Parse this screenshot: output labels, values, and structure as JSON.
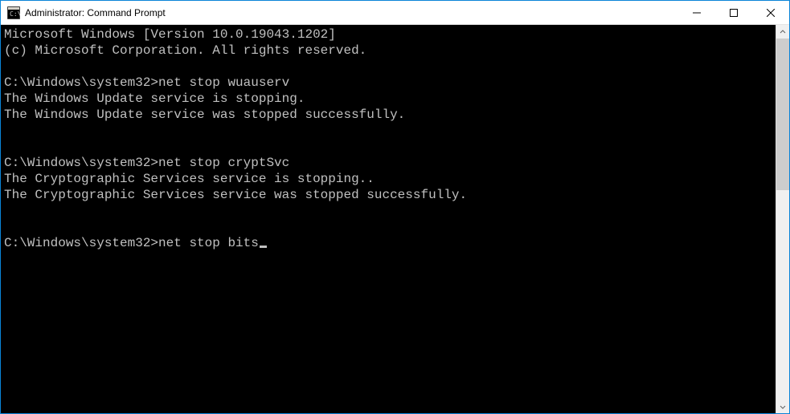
{
  "window": {
    "title": "Administrator: Command Prompt"
  },
  "terminal": {
    "lines": [
      "Microsoft Windows [Version 10.0.19043.1202]",
      "(c) Microsoft Corporation. All rights reserved.",
      "",
      {
        "prompt": "C:\\Windows\\system32>",
        "command": "net stop wuauserv"
      },
      "The Windows Update service is stopping.",
      "The Windows Update service was stopped successfully.",
      "",
      "",
      {
        "prompt": "C:\\Windows\\system32>",
        "command": "net stop cryptSvc"
      },
      "The Cryptographic Services service is stopping..",
      "The Cryptographic Services service was stopped successfully.",
      "",
      "",
      {
        "prompt": "C:\\Windows\\system32>",
        "command": "net stop bits",
        "cursor": true
      }
    ]
  }
}
